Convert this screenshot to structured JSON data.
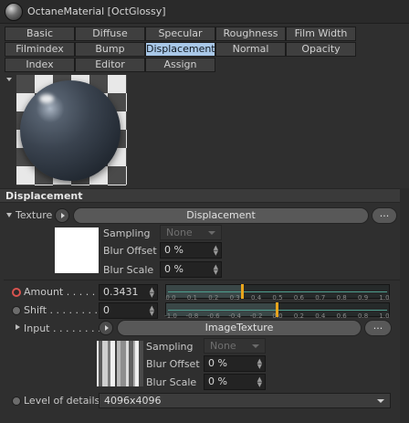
{
  "window": {
    "title": "OctaneMaterial [OctGlossy]"
  },
  "tabs": {
    "row1": [
      "Basic",
      "Diffuse",
      "Specular",
      "Roughness",
      "Film Width"
    ],
    "row2": [
      "Filmindex",
      "Bump",
      "Displacement",
      "Normal",
      "Opacity"
    ],
    "row3": [
      "Index",
      "Editor",
      "Assign"
    ],
    "active": "Displacement",
    "active_color": "#a9c8e8"
  },
  "section": {
    "title": "Displacement"
  },
  "texture": {
    "label": "Texture",
    "button_label": "Displacement",
    "more_label": "...",
    "sampling_label": "Sampling",
    "sampling_value": "None",
    "blur_offset_label": "Blur Offset",
    "blur_offset_value": "0 %",
    "blur_scale_label": "Blur Scale",
    "blur_scale_value": "0 %"
  },
  "amount": {
    "label": "Amount . . . . . .",
    "value": "0.3431",
    "ticks": [
      "0.0",
      "0.1",
      "0.2",
      "0.3",
      "0.4",
      "0.5",
      "0.6",
      "0.7",
      "0.8",
      "0.9",
      "1.0"
    ],
    "slider_fraction": 0.3431,
    "accent": "#d9534f"
  },
  "shift": {
    "label": "Shift . . . . . . . .",
    "value": "0",
    "ticks": [
      "-1.0",
      "-0.8",
      "-0.6",
      "-0.4",
      "-0.2",
      "0.0",
      "0.2",
      "0.4",
      "0.6",
      "0.8",
      "1.0"
    ],
    "slider_fraction": 0.5
  },
  "input": {
    "label": "Input . . . . . . . .",
    "button_label": "ImageTexture",
    "more_label": "...",
    "sampling_label": "Sampling",
    "sampling_value": "None",
    "blur_offset_label": "Blur Offset",
    "blur_offset_value": "0 %",
    "blur_scale_label": "Blur Scale",
    "blur_scale_value": "0 %"
  },
  "level_of_details": {
    "label": "Level of details",
    "value": "4096x4096"
  },
  "colors": {
    "marker": "#e8a41c",
    "track": "#4f9f8f"
  }
}
